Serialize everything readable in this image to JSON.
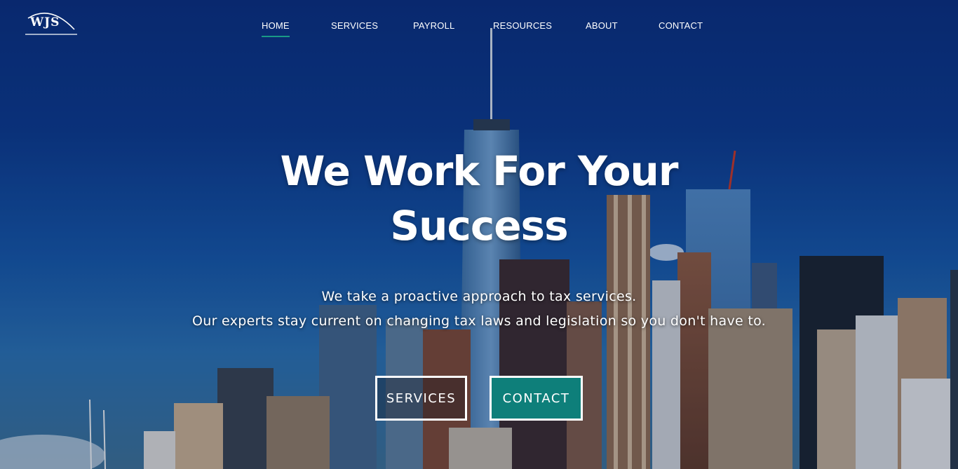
{
  "brand": {
    "logo_text": "WJS"
  },
  "nav": {
    "items": [
      {
        "label": "HOME",
        "active": true
      },
      {
        "label": "SERVICES",
        "active": false
      },
      {
        "label": "PAYROLL",
        "active": false
      },
      {
        "label": "RESOURCES",
        "active": false
      },
      {
        "label": "ABOUT",
        "active": false
      },
      {
        "label": "CONTACT",
        "active": false
      }
    ]
  },
  "hero": {
    "headline_line1": "We Work For Your",
    "headline_line2": "Success",
    "subtext_line1": "We take a proactive approach to tax services.",
    "subtext_line2": "Our experts stay current on changing tax laws and legislation so you don't have to.",
    "services_button": "SERVICES",
    "contact_button": "CONTACT"
  },
  "colors": {
    "accent": "#0e7f7a",
    "nav_underline": "#1a9a86",
    "sky_top": "#0b2f7e"
  }
}
